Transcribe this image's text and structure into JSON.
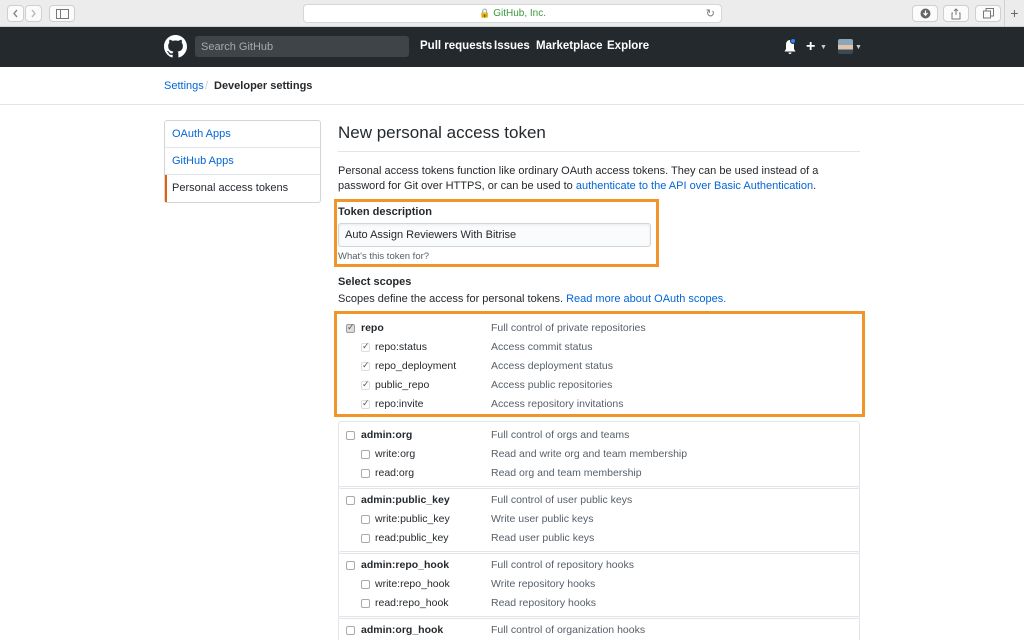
{
  "browser": {
    "url": "GitHub, Inc."
  },
  "header": {
    "search_placeholder": "Search GitHub",
    "nav": [
      "Pull requests",
      "Issues",
      "Marketplace",
      "Explore"
    ]
  },
  "breadcrumb": {
    "parent": "Settings",
    "current": "Developer settings"
  },
  "sidebar": {
    "items": [
      {
        "label": "OAuth Apps",
        "selected": false
      },
      {
        "label": "GitHub Apps",
        "selected": false
      },
      {
        "label": "Personal access tokens",
        "selected": true
      }
    ]
  },
  "main": {
    "title": "New personal access token",
    "intro_1": "Personal access tokens function like ordinary OAuth access tokens. They can be used instead of a password for Git over HTTPS, or can be used to ",
    "intro_link": "authenticate to the API over Basic Authentication",
    "intro_2": ".",
    "token_label": "Token description",
    "token_value": "Auto Assign Reviewers With Bitrise",
    "token_note": "What's this token for?",
    "scopes_label": "Select scopes",
    "scopes_desc": "Scopes define the access for personal tokens. ",
    "scopes_link": "Read more about OAuth scopes."
  },
  "scopes": [
    {
      "name": "repo",
      "desc": "Full control of private repositories",
      "checked": true,
      "children": [
        {
          "name": "repo:status",
          "desc": "Access commit status",
          "checked": true
        },
        {
          "name": "repo_deployment",
          "desc": "Access deployment status",
          "checked": true
        },
        {
          "name": "public_repo",
          "desc": "Access public repositories",
          "checked": true
        },
        {
          "name": "repo:invite",
          "desc": "Access repository invitations",
          "checked": true
        }
      ]
    },
    {
      "name": "admin:org",
      "desc": "Full control of orgs and teams",
      "checked": false,
      "children": [
        {
          "name": "write:org",
          "desc": "Read and write org and team membership",
          "checked": false
        },
        {
          "name": "read:org",
          "desc": "Read org and team membership",
          "checked": false
        }
      ]
    },
    {
      "name": "admin:public_key",
      "desc": "Full control of user public keys",
      "checked": false,
      "children": [
        {
          "name": "write:public_key",
          "desc": "Write user public keys",
          "checked": false
        },
        {
          "name": "read:public_key",
          "desc": "Read user public keys",
          "checked": false
        }
      ]
    },
    {
      "name": "admin:repo_hook",
      "desc": "Full control of repository hooks",
      "checked": false,
      "children": [
        {
          "name": "write:repo_hook",
          "desc": "Write repository hooks",
          "checked": false
        },
        {
          "name": "read:repo_hook",
          "desc": "Read repository hooks",
          "checked": false
        }
      ]
    },
    {
      "name": "admin:org_hook",
      "desc": "Full control of organization hooks",
      "checked": false,
      "children": []
    }
  ],
  "colors": {
    "highlight": "#f0952a",
    "link": "#0366d6",
    "header_bg": "#24292e",
    "selected_border": "#e36209"
  }
}
